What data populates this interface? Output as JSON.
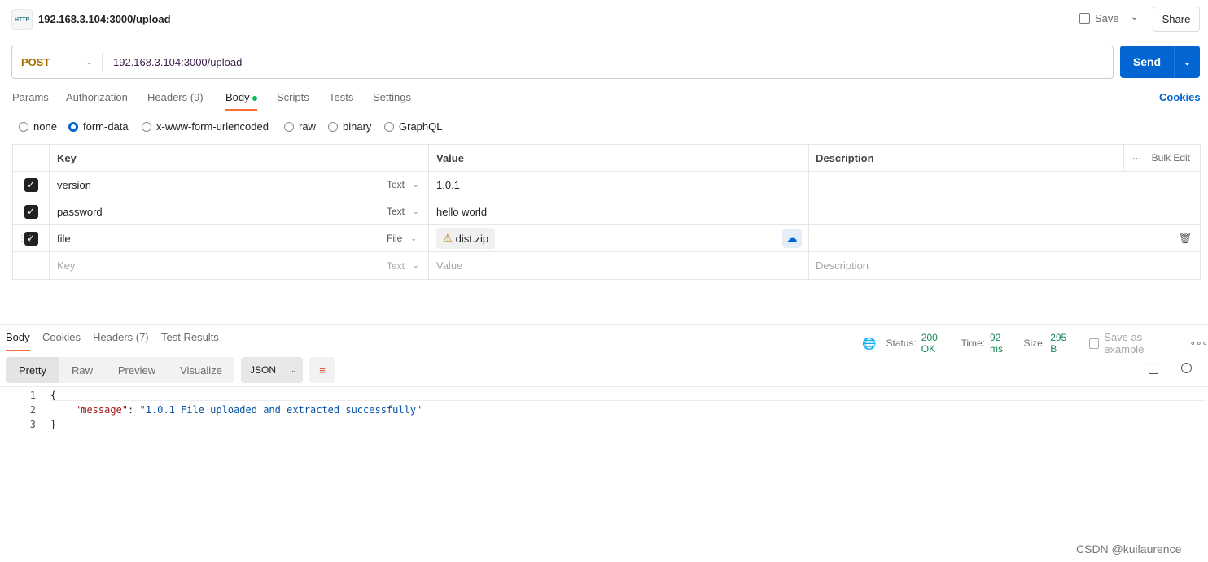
{
  "header": {
    "icon": "http-icon",
    "title": "192.168.3.104:3000/upload",
    "save_label": "Save",
    "share_label": "Share"
  },
  "request": {
    "method": "POST",
    "url": "192.168.3.104:3000/upload",
    "send_label": "Send"
  },
  "tabs": [
    {
      "label": "Params"
    },
    {
      "label": "Authorization"
    },
    {
      "label": "Headers (9)"
    },
    {
      "label": "Body",
      "active": true
    },
    {
      "label": "Scripts"
    },
    {
      "label": "Tests"
    },
    {
      "label": "Settings"
    }
  ],
  "cookies_link": "Cookies",
  "body_types": [
    {
      "label": "none"
    },
    {
      "label": "form-data",
      "selected": true
    },
    {
      "label": "x-www-form-urlencoded"
    },
    {
      "label": "raw"
    },
    {
      "label": "binary"
    },
    {
      "label": "GraphQL"
    }
  ],
  "table": {
    "headers": {
      "key": "Key",
      "value": "Value",
      "description": "Description",
      "bulk_edit": "Bulk Edit"
    },
    "rows": [
      {
        "key": "version",
        "type": "Text",
        "value": "1.0.1",
        "checked": true
      },
      {
        "key": "password",
        "type": "Text",
        "value": "hello world",
        "checked": true
      },
      {
        "key": "file",
        "type": "File",
        "value": "dist.zip",
        "checked": true
      }
    ],
    "new_row": {
      "key_placeholder": "Key",
      "type": "Text",
      "value_placeholder": "Value",
      "description_placeholder": "Description"
    }
  },
  "response": {
    "tabs": [
      {
        "label": "Body",
        "active": true
      },
      {
        "label": "Cookies"
      },
      {
        "label": "Headers (7)"
      },
      {
        "label": "Test Results"
      }
    ],
    "status_label": "Status:",
    "status": "200 OK",
    "time_label": "Time:",
    "time": "92 ms",
    "size_label": "Size:",
    "size": "295 B",
    "save_example": "Save as example",
    "views": [
      "Pretty",
      "Raw",
      "Preview",
      "Visualize"
    ],
    "format": "JSON",
    "lines": [
      "1",
      "2",
      "3"
    ],
    "code": {
      "open": "{",
      "key": "\"message\"",
      "colon": ": ",
      "value": "\"1.0.1 File uploaded and extracted successfully\"",
      "close": "}"
    }
  },
  "watermark": "CSDN @kuilaurence",
  "colors": {
    "accent": "#0265d2",
    "orange": "#ff6c37",
    "status_green": "#1a8754",
    "method": "#a86b00"
  }
}
